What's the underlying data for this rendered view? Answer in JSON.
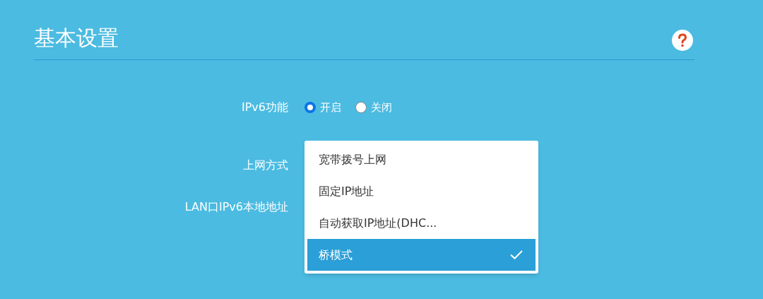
{
  "title": "基本设置",
  "ipv6": {
    "label": "IPv6功能",
    "options": [
      {
        "label": "开启",
        "selected": true
      },
      {
        "label": "关闭",
        "selected": false
      }
    ]
  },
  "connection": {
    "label": "上网方式",
    "options": [
      {
        "label": "宽带拨号上网",
        "selected": false
      },
      {
        "label": "固定IP地址",
        "selected": false
      },
      {
        "label": "自动获取IP地址(DHC...",
        "selected": false
      },
      {
        "label": "桥模式",
        "selected": true
      }
    ]
  },
  "lan_label": "LAN口IPv6本地地址"
}
